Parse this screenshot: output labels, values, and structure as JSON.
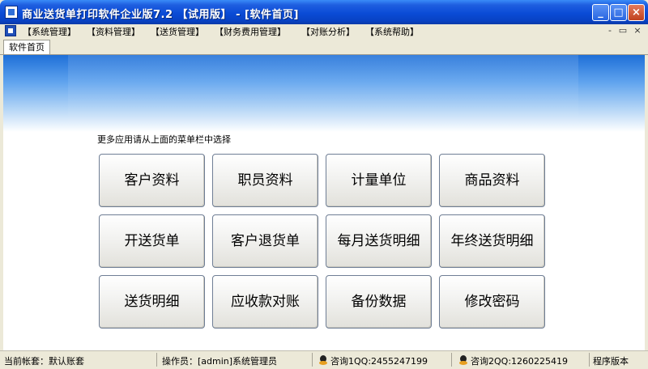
{
  "window": {
    "title": "商业送货单打印软件企业版7.2 【试用版】 - [软件首页]",
    "minimize_glyph": "_",
    "maximize_glyph": "□",
    "close_glyph": "×"
  },
  "menu": {
    "items": [
      "【系统管理】",
      "【资料管理】",
      "【送货管理】",
      "【财务费用管理】",
      "【对账分析】",
      "【系统帮助】"
    ],
    "mdi_min": "-",
    "mdi_restore": "▭",
    "mdi_close": "×"
  },
  "tabs": [
    "软件首页"
  ],
  "content": {
    "hint": "更多应用请从上面的菜单栏中选择",
    "buttons": [
      "客户资料",
      "职员资料",
      "计量单位",
      "商品资料",
      "开送货单",
      "客户退货单",
      "每月送货明细",
      "年终送货明细",
      "送货明细",
      "应收款对账",
      "备份数据",
      "修改密码"
    ]
  },
  "status": {
    "account": "当前帐套：默认账套",
    "operator": "操作员：[admin]系统管理员",
    "qq1": "咨询1QQ:2455247199",
    "qq2": "咨询2QQ:1260225419",
    "version": "程序版本"
  },
  "colors": {
    "titlebar": "#0A4BD6",
    "banner": "#1E6FD8",
    "chrome": "#ECE9D8"
  },
  "icons": [
    "app-icon",
    "minimize-icon",
    "maximize-icon",
    "close-icon",
    "qq-icon"
  ]
}
